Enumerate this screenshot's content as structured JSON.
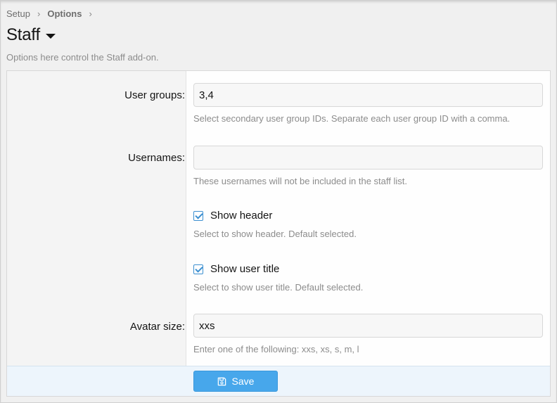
{
  "breadcrumb": {
    "items": [
      "Setup",
      "Options"
    ]
  },
  "page": {
    "title": "Staff",
    "description": "Options here control the Staff add-on."
  },
  "options": {
    "user_groups": {
      "label": "User groups:",
      "value": "3,4",
      "hint": "Select secondary user group IDs. Separate each user group ID with a comma."
    },
    "usernames": {
      "label": "Usernames:",
      "value": "",
      "hint": "These usernames will not be included in the staff list."
    },
    "show_header": {
      "label": "Show header",
      "checked": true,
      "hint": "Select to show header. Default selected."
    },
    "show_user_title": {
      "label": "Show user title",
      "checked": true,
      "hint": "Select to show user title. Default selected."
    },
    "avatar_size": {
      "label": "Avatar size:",
      "value": "xxs",
      "hint": "Enter one of the following: xxs, xs, s, m, l"
    }
  },
  "footer": {
    "save_label": "Save"
  },
  "colors": {
    "accent": "#47a7eb",
    "checkbox": "#3b8fd0",
    "footer_bg": "#edf5fc"
  },
  "icons": {
    "caret": "caret-down-icon",
    "save": "floppy-disk-icon",
    "check": "checkmark-icon"
  }
}
